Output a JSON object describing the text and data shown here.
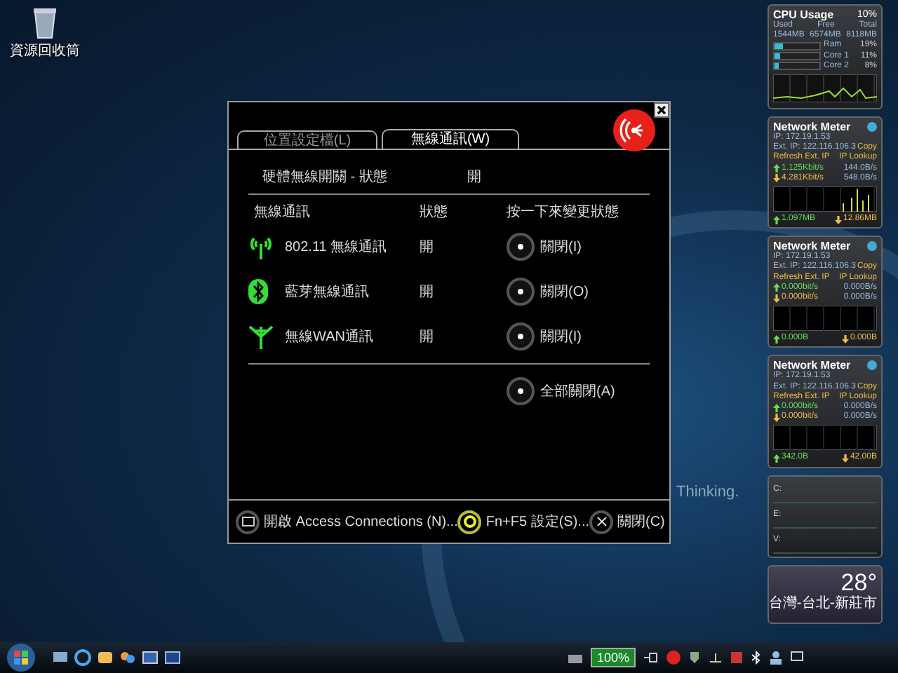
{
  "desktop": {
    "icons": [
      {
        "label": "資源回收筒"
      }
    ],
    "wallpaper_text": "Thinking."
  },
  "dialog": {
    "tabs": [
      {
        "label": "位置設定檔(L)",
        "selected": false
      },
      {
        "label": "無線通訊(W)",
        "selected": true
      }
    ],
    "hardware_switch": {
      "label": "硬體無線開關 - 狀態",
      "value": "開"
    },
    "columns": [
      "無線通訊",
      "狀態",
      "按一下來變更狀態"
    ],
    "radios": [
      {
        "kind": "wifi",
        "name": "802.11 無線通訊",
        "status": "開",
        "action": "關閉(I)"
      },
      {
        "kind": "bluetooth",
        "name": "藍芽無線通訊",
        "status": "開",
        "action": "關閉(O)"
      },
      {
        "kind": "wan",
        "name": "無線WAN通訊",
        "status": "開",
        "action": "關閉(I)"
      }
    ],
    "all_off": "全部關閉(A)",
    "footer": [
      {
        "kind": "monitor",
        "label": "開啟 Access Connections (N)..."
      },
      {
        "kind": "ring",
        "label": "Fn+F5 設定(S)..."
      },
      {
        "kind": "close",
        "label": "關閉(C)"
      }
    ]
  },
  "gadgets": {
    "cpu": {
      "title": "CPU Usage",
      "total": "10%",
      "headers": [
        "Used",
        "Free",
        "Total"
      ],
      "values": [
        "1544MB",
        "6574MB",
        "8118MB"
      ],
      "meters": [
        {
          "name": "Ram",
          "reading": "19%",
          "level": 0.19
        },
        {
          "name": "Core 1",
          "reading": "11%",
          "level": 0.11
        },
        {
          "name": "Core 2",
          "reading": "8%",
          "level": 0.08
        }
      ]
    },
    "network_meters": [
      {
        "title": "Network Meter",
        "ip": "IP: 172.19.1.53",
        "ext_ip": "Ext. IP: 122.116.106.3",
        "copy": "Copy",
        "refresh": "Refresh Ext. IP",
        "lookup": "IP Lookup",
        "up_rate": "1.125Kbit/s",
        "up_bytes": "144.0B/s",
        "down_rate": "4.281Kbit/s",
        "down_bytes": "548.0B/s",
        "sent": "1.097MB",
        "received": "12.86MB"
      },
      {
        "title": "Network Meter",
        "ip": "IP: 172.19.1.53",
        "ext_ip": "Ext. IP: 122.116.106.3",
        "copy": "Copy",
        "refresh": "Refresh Ext. IP",
        "lookup": "IP Lookup",
        "up_rate": "0.000bit/s",
        "up_bytes": "0.000B/s",
        "down_rate": "0.000bit/s",
        "down_bytes": "0.000B/s",
        "sent": "0.000B",
        "received": "0.000B"
      },
      {
        "title": "Network Meter",
        "ip": "IP: 172.19.1.53",
        "ext_ip": "Ext. IP: 122.116.106.3",
        "copy": "Copy",
        "refresh": "Refresh Ext. IP",
        "lookup": "IP Lookup",
        "up_rate": "0.000bit/s",
        "up_bytes": "0.000B/s",
        "down_rate": "0.000bit/s",
        "down_bytes": "0.000B/s",
        "sent": "342.0B",
        "received": "42.00B"
      }
    ],
    "drives": [
      "C:",
      "E:",
      "V:"
    ],
    "weather": {
      "temperature": "28°",
      "location": "台灣-台北-新莊市"
    }
  },
  "taskbar": {
    "battery": {
      "label": "100%",
      "level": 1
    }
  }
}
